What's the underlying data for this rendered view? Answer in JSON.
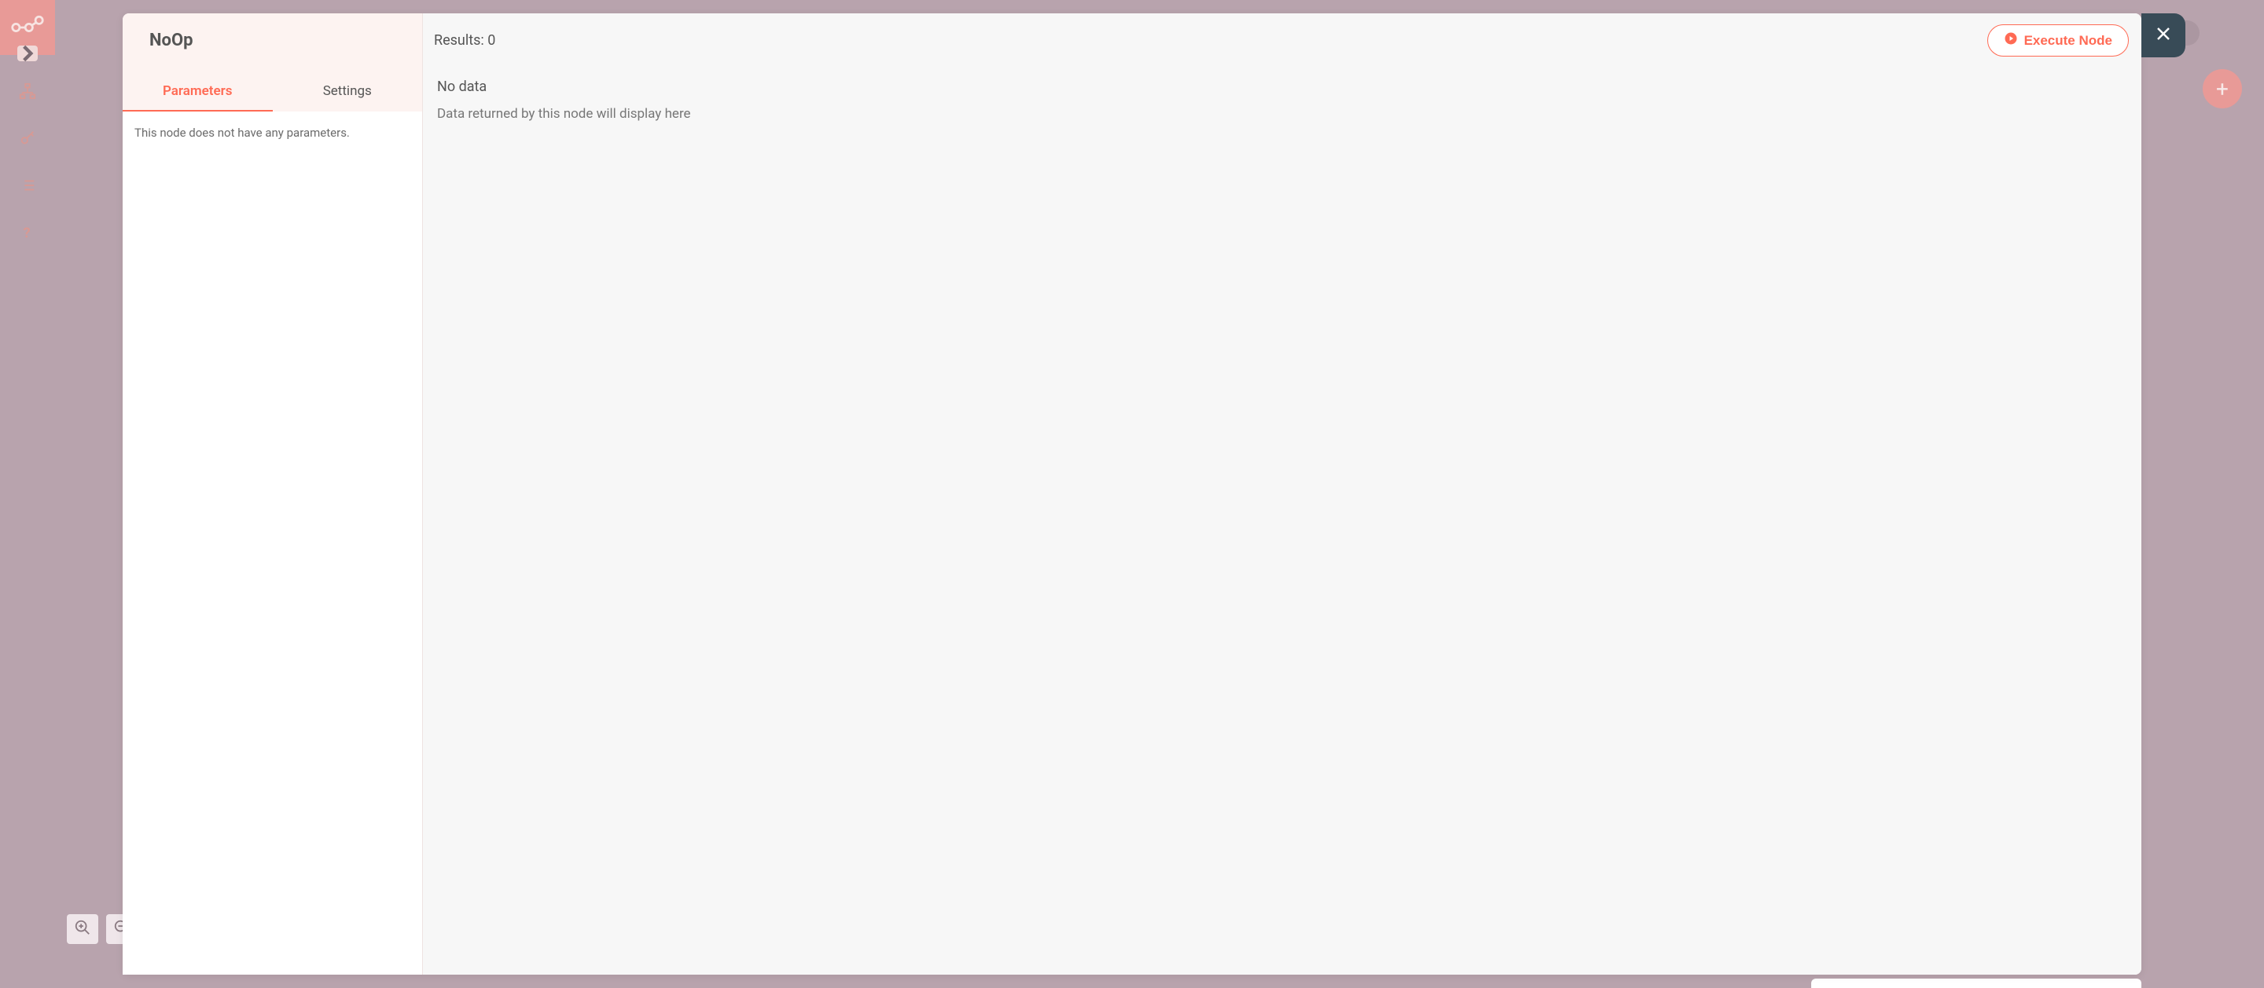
{
  "sidebar": {
    "items": [
      {
        "name": "workflows-icon"
      },
      {
        "name": "credentials-icon"
      },
      {
        "name": "executions-icon"
      },
      {
        "name": "help-icon"
      }
    ]
  },
  "modal": {
    "title": "NoOp",
    "tabs": [
      {
        "label": "Parameters",
        "active": true
      },
      {
        "label": "Settings",
        "active": false
      }
    ],
    "parameters_empty_text": "This node does not have any parameters.",
    "results_label": "Results: 0",
    "execute_label": "Execute Node",
    "no_data_label": "No data",
    "data_hint": "Data returned by this node will display here"
  },
  "zoom": {
    "in": "zoom-in",
    "out": "zoom-out"
  },
  "add_button": "+"
}
